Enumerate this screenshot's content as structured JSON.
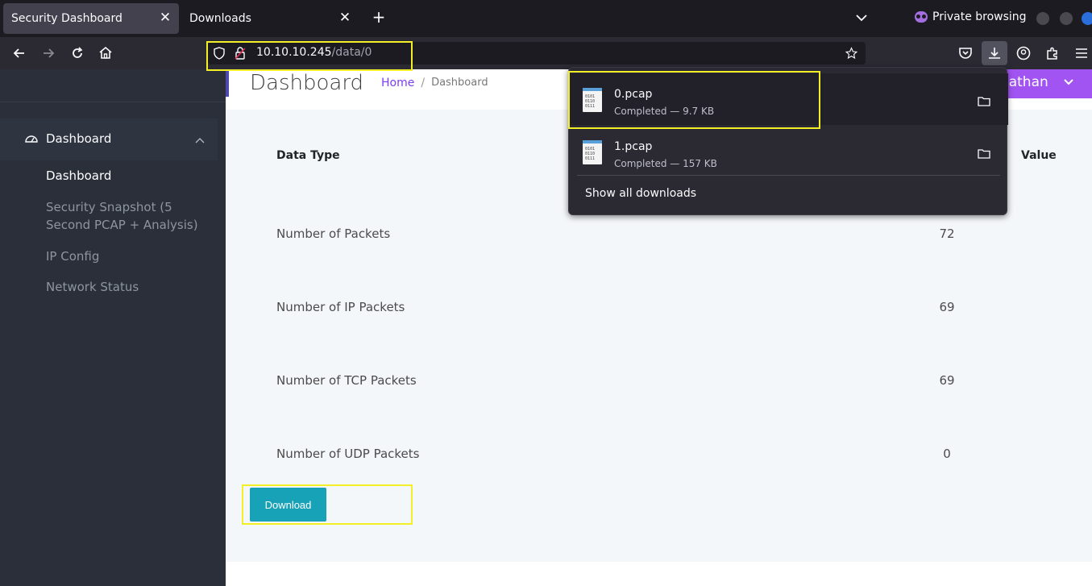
{
  "tabs": [
    {
      "title": "Security Dashboard",
      "close": "✕"
    },
    {
      "title": "Downloads",
      "close": "✕"
    }
  ],
  "new_tab": "+",
  "private_browsing": "Private browsing",
  "url": {
    "host": "10.10.10.245",
    "path": "/data/0"
  },
  "sidebar": {
    "group_label": "Dashboard",
    "items": [
      {
        "label": "Dashboard"
      },
      {
        "label": "Security Snapshot (5 Second PCAP + Analysis)"
      },
      {
        "label": "IP Config"
      },
      {
        "label": "Network Status"
      }
    ]
  },
  "header": {
    "title": "Dashboard",
    "breadcrumb_home": "Home",
    "breadcrumb_sep": "/",
    "breadcrumb_current": "Dashboard",
    "user_name": "Nathan"
  },
  "table": {
    "col_type": "Data Type",
    "col_value": "Value",
    "rows": [
      {
        "label": "Number of Packets",
        "value": "72"
      },
      {
        "label": "Number of IP Packets",
        "value": "69"
      },
      {
        "label": "Number of TCP Packets",
        "value": "69"
      },
      {
        "label": "Number of UDP Packets",
        "value": "0"
      }
    ]
  },
  "download_button": "Download",
  "downloads": {
    "items": [
      {
        "name": "0.pcap",
        "status": "Completed — 9.7 KB"
      },
      {
        "name": "1.pcap",
        "status": "Completed — 157 KB"
      }
    ],
    "show_all": "Show all downloads",
    "file_icon_text": "0101\n0110\n0111"
  },
  "colors": {
    "highlight": "#f2ef27",
    "download_button": "#17a2b8",
    "user_button": "#a154f2",
    "breadcrumb_link": "#7d3cf0"
  }
}
